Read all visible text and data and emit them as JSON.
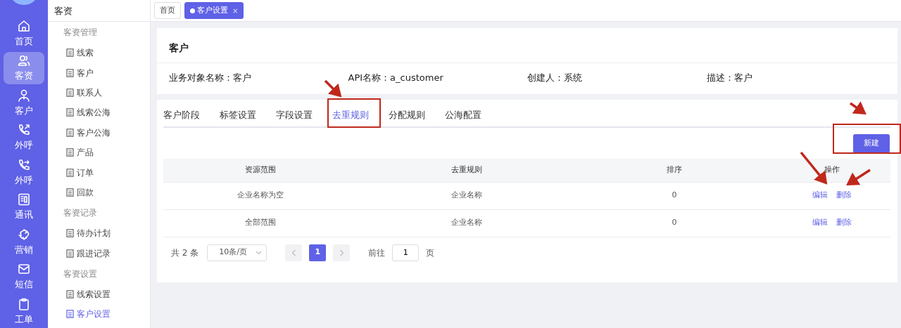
{
  "nav_rail": {
    "items": [
      {
        "label": "首页",
        "selected": false
      },
      {
        "label": "客资",
        "selected": true
      },
      {
        "label": "客户",
        "selected": false
      },
      {
        "label": "外呼",
        "selected": false
      },
      {
        "label": "外呼",
        "selected": false
      },
      {
        "label": "通讯",
        "selected": false
      },
      {
        "label": "营销",
        "selected": false
      },
      {
        "label": "短信",
        "selected": false
      },
      {
        "label": "工单",
        "selected": false
      }
    ]
  },
  "sidebar": {
    "title": "客资",
    "groups": [
      {
        "label": "客资管理",
        "items": [
          {
            "label": "线索",
            "selected": false
          },
          {
            "label": "客户",
            "selected": false
          },
          {
            "label": "联系人",
            "selected": false
          },
          {
            "label": "线索公海",
            "selected": false
          },
          {
            "label": "客户公海",
            "selected": false
          },
          {
            "label": "产品",
            "selected": false
          },
          {
            "label": "订单",
            "selected": false
          },
          {
            "label": "回款",
            "selected": false
          }
        ]
      },
      {
        "label": "客资记录",
        "items": [
          {
            "label": "待办计划",
            "selected": false
          },
          {
            "label": "跟进记录",
            "selected": false
          }
        ]
      },
      {
        "label": "客资设置",
        "items": [
          {
            "label": "线索设置",
            "selected": false
          },
          {
            "label": "客户设置",
            "selected": true
          }
        ]
      }
    ]
  },
  "page_tabs": [
    {
      "label": "首页",
      "selected": false
    },
    {
      "label": "客户设置",
      "selected": true,
      "close": "×"
    }
  ],
  "object_card": {
    "title": "客户",
    "fields": [
      {
        "label": "业务对象名称：",
        "value": "客户"
      },
      {
        "label": "API名称：",
        "value": "a_customer"
      },
      {
        "label": "创建人：",
        "value": "系统"
      },
      {
        "label": "描述：",
        "value": "客户"
      }
    ]
  },
  "settings_tabs": [
    {
      "label": "客户阶段",
      "selected": false
    },
    {
      "label": "标签设置",
      "selected": false
    },
    {
      "label": "字段设置",
      "selected": false
    },
    {
      "label": "去重规则",
      "selected": true
    },
    {
      "label": "分配规则",
      "selected": false
    },
    {
      "label": "公海配置",
      "selected": false
    }
  ],
  "new_button": "新建",
  "table": {
    "columns": [
      "资源范围",
      "去重规则",
      "排序",
      "操作"
    ],
    "rows": [
      {
        "cells": [
          "企业名称为空",
          "企业名称",
          "0"
        ],
        "actions": [
          "编辑",
          "删除"
        ]
      },
      {
        "cells": [
          "全部范围",
          "企业名称",
          "0"
        ],
        "actions": [
          "编辑",
          "删除"
        ]
      }
    ]
  },
  "pagination": {
    "total": "共 2 条",
    "page_size": "10条/页",
    "pages": [
      {
        "label": "1",
        "selected": true
      }
    ],
    "goto_label": "前往",
    "goto_value": "1",
    "goto_suffix": "页"
  }
}
